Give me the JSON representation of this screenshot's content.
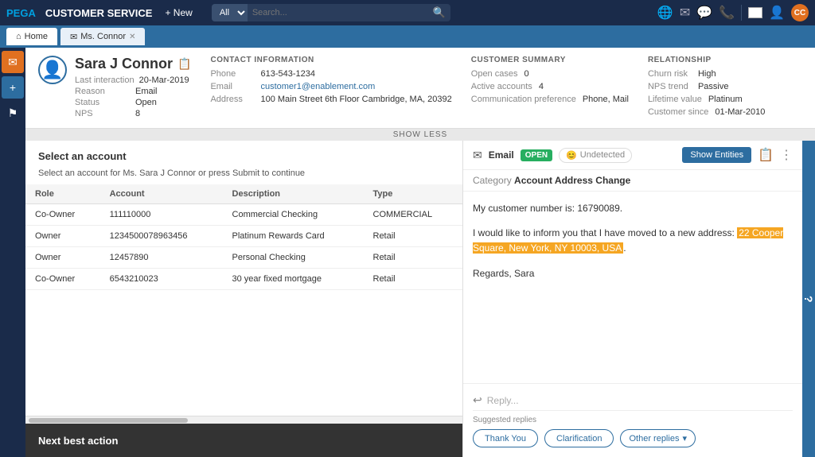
{
  "nav": {
    "logo": "PEGA",
    "app_name": "CUSTOMER SERVICE",
    "new_label": "+ New",
    "search_placeholder": "Search...",
    "search_filter": "All",
    "icons": [
      "🌐",
      "✉",
      "💬",
      "📞"
    ],
    "avatar": "CC"
  },
  "subnav": {
    "home_tab": "Home",
    "customer_tab": "Ms. Connor",
    "close_symbol": "✕"
  },
  "customer": {
    "name": "Sara J Connor",
    "last_interaction_label": "Last interaction",
    "last_interaction_value": "20-Mar-2019",
    "reason_label": "Reason",
    "reason_value": "Email",
    "status_label": "Status",
    "status_value": "Open",
    "nps_label": "NPS",
    "nps_value": "8"
  },
  "contact_info": {
    "title": "CONTACT INFORMATION",
    "phone_label": "Phone",
    "phone_value": "613-543-1234",
    "email_label": "Email",
    "email_value": "customer1@enablement.com",
    "address_label": "Address",
    "address_value": "100 Main Street 6th Floor Cambridge, MA, 20392"
  },
  "customer_summary": {
    "title": "CUSTOMER SUMMARY",
    "open_cases_label": "Open cases",
    "open_cases_value": "0",
    "active_accounts_label": "Active accounts",
    "active_accounts_value": "4",
    "comm_pref_label": "Communication preference",
    "comm_pref_value": "Phone, Mail"
  },
  "relationship": {
    "title": "RELATIONSHIP",
    "churn_risk_label": "Churn risk",
    "churn_risk_value": "High",
    "nps_trend_label": "NPS trend",
    "nps_trend_value": "Passive",
    "lifetime_value_label": "Lifetime value",
    "lifetime_value_value": "Platinum",
    "customer_since_label": "Customer since",
    "customer_since_value": "01-Mar-2010"
  },
  "show_less": "SHOW LESS",
  "account_panel": {
    "title": "Select an account",
    "subtitle": "Select an account for Ms. Sara J Connor or press Submit to continue",
    "columns": [
      "Role",
      "Account",
      "Description",
      "Type"
    ],
    "rows": [
      {
        "role": "Co-Owner",
        "account": "111110000",
        "description": "Commercial Checking",
        "type": "COMMERCIAL"
      },
      {
        "role": "Owner",
        "account": "1234500078963456",
        "description": "Platinum Rewards Card",
        "type": "Retail"
      },
      {
        "role": "Owner",
        "account": "12457890",
        "description": "Personal Checking",
        "type": "Retail"
      },
      {
        "role": "Co-Owner",
        "account": "6543210023",
        "description": "30 year fixed mortgage",
        "type": "Retail"
      }
    ]
  },
  "next_best_action": {
    "label": "Next best action"
  },
  "email_panel": {
    "channel": "Email",
    "status": "OPEN",
    "undetected": "Undetected",
    "show_entities": "Show Entities",
    "category_label": "Category",
    "category_value": "Account Address Change",
    "body_line1": "My customer number is: 16790089.",
    "body_line2": "I would like to inform you that I have moved to a new address: ",
    "highlighted": "22 Cooper Square, New York, NY 10003, USA",
    "body_end": ".",
    "regards": "Regards, Sara",
    "reply_placeholder": "Reply...",
    "suggested_label": "Suggested replies",
    "reply1": "Thank You",
    "reply2": "Clarification",
    "reply3": "Other replies",
    "chevron": "▾"
  }
}
